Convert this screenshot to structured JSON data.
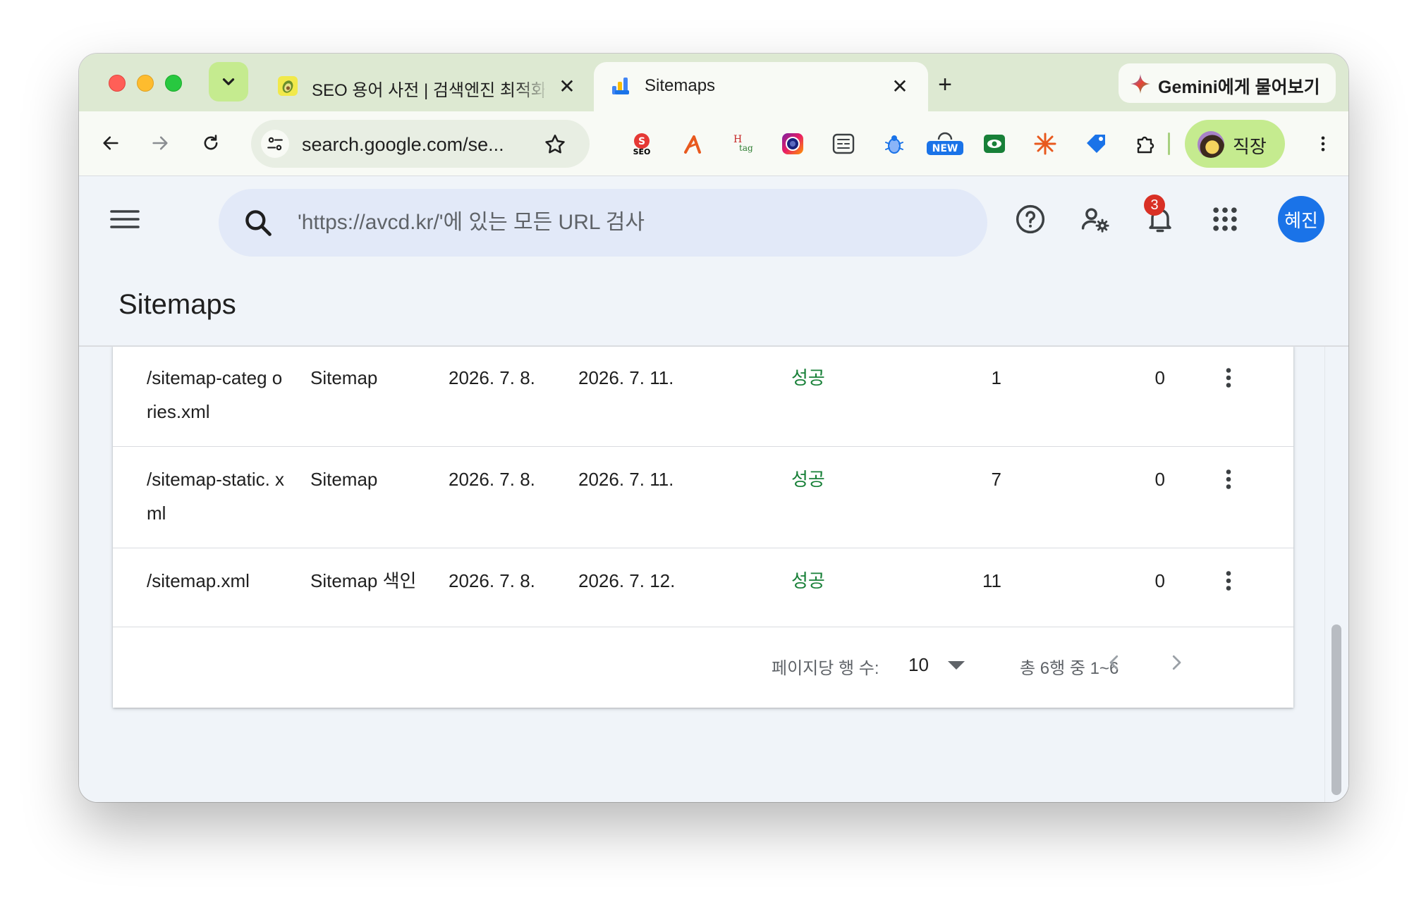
{
  "browser": {
    "tabs": [
      {
        "title": "SEO 용어 사전 | 검색엔진 최적화의",
        "active": false
      },
      {
        "title": "Sitemaps",
        "active": true
      }
    ],
    "gemini_label": "Gemini에게 물어보기",
    "url": "search.google.com/se...",
    "profile_label": "직장",
    "extensions": [
      "seo-extension-icon",
      "tool-extension-icon",
      "htag-extension-icon",
      "camera-extension-icon",
      "capture-extension-icon",
      "bug-extension-icon",
      "new-extension-icon",
      "eye-extension-icon",
      "asterisk-extension-icon",
      "tag-extension-icon",
      "puzzle-icon"
    ],
    "new_badge": "NEW",
    "seo_badge": "SEO",
    "htag_label": "tag",
    "htag_h": "H"
  },
  "header": {
    "search_placeholder": "'https://avcd.kr/'에 있는 모든 URL 검사",
    "notification_count": "3",
    "avatar_label": "혜진"
  },
  "page": {
    "title": "Sitemaps"
  },
  "table": {
    "rows": [
      {
        "path": "/sitemap-categ ories.xml",
        "type": "Sitemap",
        "submitted": "2026. 7. 8.",
        "last_read": "2026. 7. 11.",
        "status": "성공",
        "discovered_pages": "1",
        "discovered_videos": "0"
      },
      {
        "path": "/sitemap-static. xml",
        "type": "Sitemap",
        "submitted": "2026. 7. 8.",
        "last_read": "2026. 7. 11.",
        "status": "성공",
        "discovered_pages": "7",
        "discovered_videos": "0"
      },
      {
        "path": "/sitemap.xml",
        "type": "Sitemap 색인",
        "submitted": "2026. 7. 8.",
        "last_read": "2026. 7. 12.",
        "status": "성공",
        "discovered_pages": "11",
        "discovered_videos": "0"
      }
    ],
    "pagination": {
      "rows_per_page_label": "페이지당 행 수:",
      "rows_per_page": "10",
      "range": "총 6행 중 1~6"
    }
  },
  "colors": {
    "tabstrip": "#dde9d2",
    "accent_green": "#c5eb8f",
    "status_success": "#188038",
    "gsc_bg": "#f0f4f9",
    "avatar": "#1a73e8",
    "badge": "#d93025"
  }
}
